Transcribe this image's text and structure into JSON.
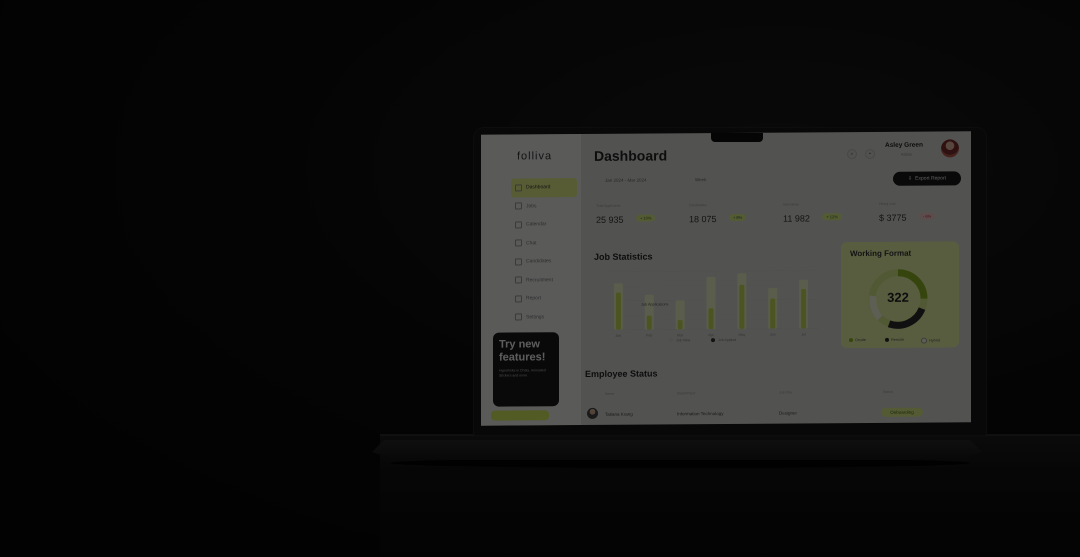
{
  "app": {
    "logo": "folliva",
    "title": "Dashboard"
  },
  "header": {
    "user_name": "Asley Green",
    "user_role": "Admin",
    "date_range": "Jan 2024 - Mar 2024",
    "period": "Week",
    "export_label": "Export Report"
  },
  "sidebar": {
    "items": [
      {
        "label": "Dashboard"
      },
      {
        "label": "Jobs"
      },
      {
        "label": "Calendar"
      },
      {
        "label": "Chat"
      },
      {
        "label": "Candidates"
      },
      {
        "label": "Recruitment"
      },
      {
        "label": "Report"
      },
      {
        "label": "Settings"
      }
    ],
    "promo": {
      "title": "Try new features!",
      "desc": "Hyperlinks in Chats, Animated Stickers and more"
    }
  },
  "stats": [
    {
      "label": "Total Applicants",
      "value": "25 935",
      "change": "+ 10%",
      "direction": "up"
    },
    {
      "label": "Candidates",
      "value": "18 075",
      "change": "+ 8%",
      "direction": "up"
    },
    {
      "label": "Interviews",
      "value": "11 982",
      "change": "+ 12%",
      "direction": "up"
    },
    {
      "label": "Hiring cost",
      "value": "$ 3775",
      "change": "- 6%",
      "direction": "down"
    }
  ],
  "job_statistics": {
    "title": "Job Statistics",
    "note": "Job Applications",
    "legend": [
      "Job View",
      "Job Applied"
    ]
  },
  "working_format": {
    "title": "Working Format",
    "total": "322",
    "legend": [
      "Onsite",
      "Remote",
      "Hybrid"
    ]
  },
  "employee_status": {
    "title": "Employee Status",
    "columns": [
      "Name",
      "Department",
      "Job Title",
      "Status"
    ],
    "rows": [
      {
        "name": "Tatiana Krang",
        "department": "Information Technology",
        "job_title": "Designer",
        "status": "Onboarding"
      }
    ]
  },
  "colors": {
    "accent": "#d7ef5c",
    "dark": "#1a1a1a",
    "screen_bg": "#d8d8d4"
  },
  "chart_data": {
    "type": "bar",
    "title": "Job Statistics",
    "categories": [
      "Jan",
      "Feb",
      "Mar",
      "Apr",
      "May",
      "Jun",
      "Jul"
    ],
    "series": [
      {
        "name": "Job View",
        "values": [
          40,
          30,
          25,
          45,
          48,
          35,
          42
        ]
      },
      {
        "name": "Job Applied",
        "values": [
          32,
          12,
          8,
          18,
          38,
          26,
          34
        ]
      }
    ],
    "ylim": [
      0,
      50
    ]
  }
}
